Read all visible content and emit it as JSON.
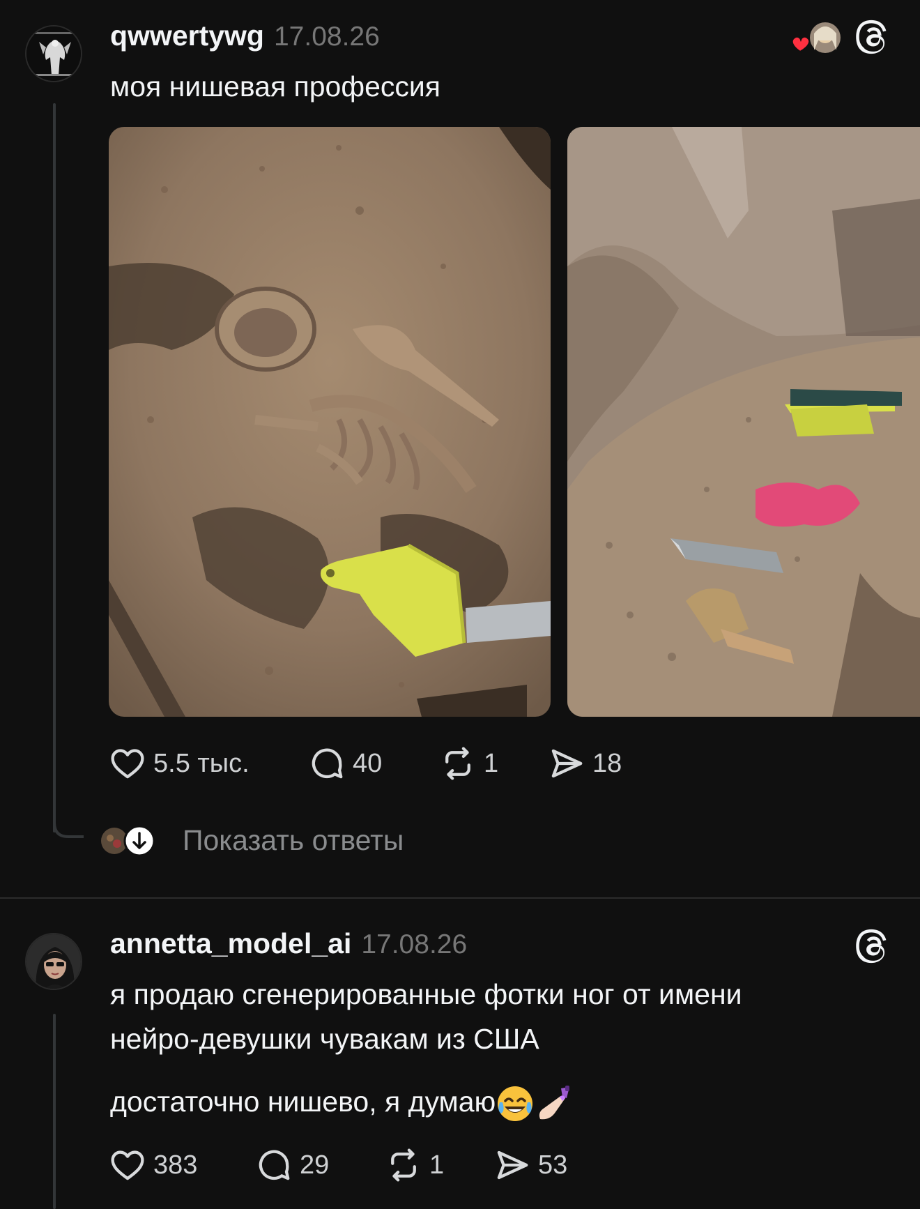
{
  "post1": {
    "username": "qwwertywg",
    "timestamp": "17.08.26",
    "text": "моя нишевая профессия",
    "stats": {
      "likes": "5.5 тыс.",
      "comments": "40",
      "reposts": "1",
      "shares": "18"
    },
    "show_replies_label": "Показать ответы"
  },
  "post2": {
    "username": "annetta_model_ai",
    "timestamp": "17.08.26",
    "text_line1": "я продаю сгенерированные фотки ног от имени",
    "text_line2": "нейро-девушки чувакам из США",
    "text_para2": "достаточно нишево, я думаю",
    "stats": {
      "likes": "383",
      "comments": "29",
      "reposts": "1",
      "shares": "53"
    }
  },
  "colors": {
    "background": "#101010",
    "text": "#f3f5f7",
    "muted": "#777777",
    "heart": "#ff3040",
    "scoop": "#d9e04a"
  },
  "icons": [
    "heart-icon",
    "comment-icon",
    "repost-icon",
    "share-icon",
    "threads-logo-icon",
    "arrow-down-icon"
  ]
}
